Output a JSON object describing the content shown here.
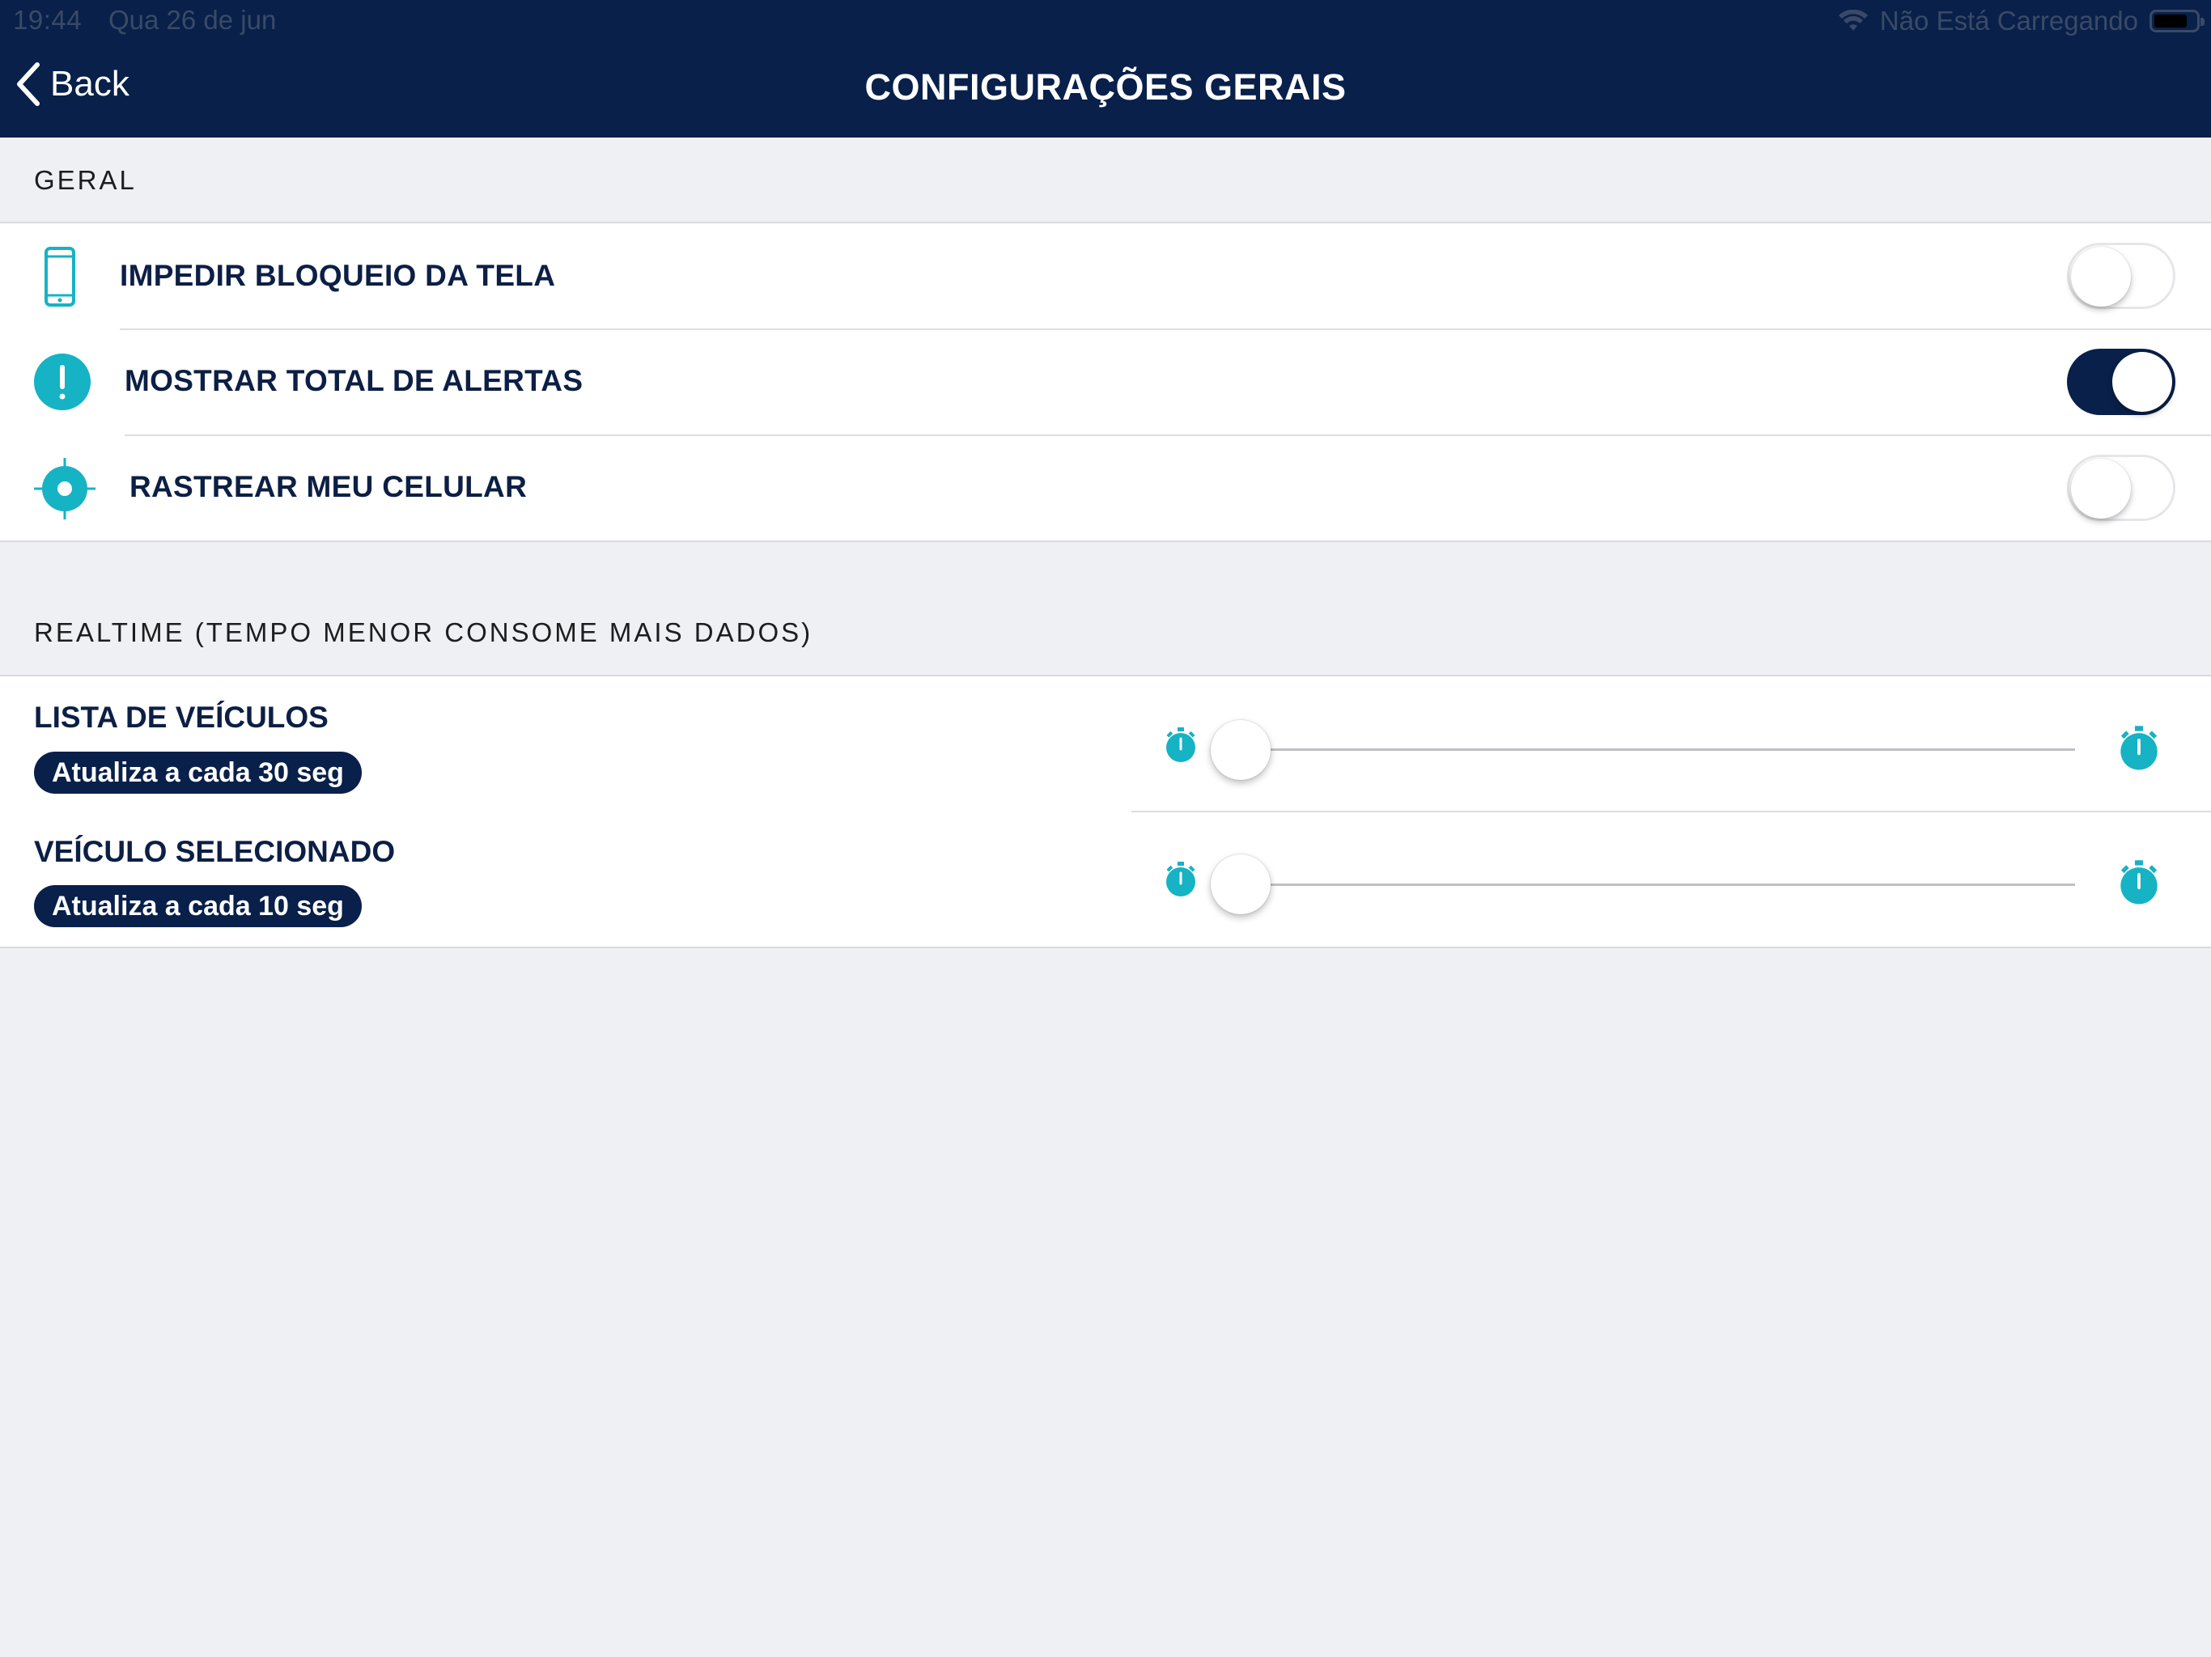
{
  "status_bar": {
    "time": "19:44",
    "date": "Qua 26 de jun",
    "charging": "Não Está Carregando"
  },
  "navbar": {
    "back_label": "Back",
    "title": "CONFIGURAÇÕES GERAIS"
  },
  "general": {
    "header": "GERAL",
    "items": [
      {
        "label": "IMPEDIR BLOQUEIO DA TELA",
        "icon": "phone-icon",
        "enabled": false
      },
      {
        "label": "MOSTRAR TOTAL DE ALERTAS",
        "icon": "alert-icon",
        "enabled": true
      },
      {
        "label": "RASTREAR MEU CELULAR",
        "icon": "target-icon",
        "enabled": false
      }
    ]
  },
  "realtime": {
    "header": "REALTIME (TEMPO MENOR CONSOME MAIS DADOS)",
    "items": [
      {
        "label": "LISTA DE VEÍCULOS",
        "badge": "Atualiza a cada 30 seg",
        "slider_value": 0
      },
      {
        "label": "VEÍCULO SELECIONADO",
        "badge": "Atualiza a cada 10 seg",
        "slider_value": 0
      }
    ]
  },
  "colors": {
    "navy": "#08204a",
    "teal": "#15b3c4",
    "background": "#eff0f4"
  }
}
